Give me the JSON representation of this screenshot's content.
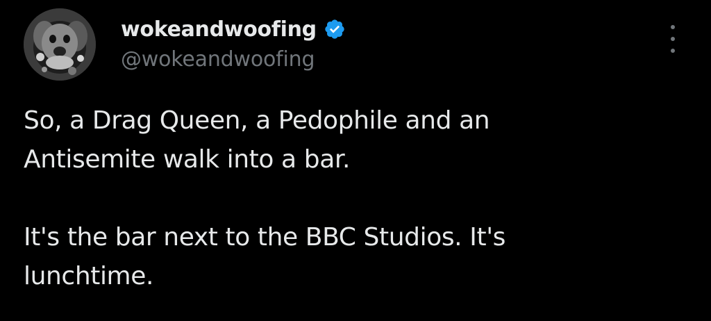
{
  "author": {
    "display_name": "wokeandwoofing",
    "handle": "@wokeandwoofing",
    "verified": true,
    "verified_badge_color": "#1d9bf0",
    "avatar_icon": "dog-avatar-icon"
  },
  "menu": {
    "icon": "more-vertical-icon"
  },
  "tweet": {
    "lines_para1": [
      "So, a Drag Queen, a Pedophile and an",
      "Antisemite walk into a bar."
    ],
    "lines_para2": [
      "It's the bar next to the BBC Studios. It's",
      "lunchtime."
    ]
  },
  "colors": {
    "background": "#000000",
    "primary_text": "#e7e9ea",
    "secondary_text": "#71767b"
  }
}
